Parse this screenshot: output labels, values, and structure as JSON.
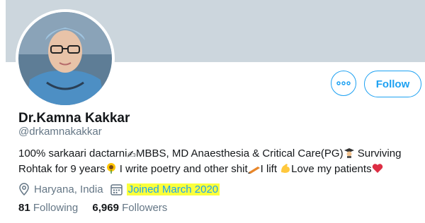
{
  "profile": {
    "display_name": "Dr.Kamna Kakkar",
    "handle": "@drkamnakakkar",
    "bio": {
      "line1_a": "100% sarkaari dactarni",
      "line1_b": "MBBS, MD Anaesthesia & Critical Care(PG)",
      "line1_c": " Surviving",
      "line2_a": "Rohtak for 9 years",
      "line2_b": " I write poetry and other shit",
      "line2_c": "I lift ",
      "line2_d": "Love my patients"
    },
    "location": "Haryana, India",
    "joined": "Joined March 2020",
    "following_count": "81",
    "following_label": "Following",
    "followers_count": "6,969",
    "followers_label": "Followers"
  },
  "actions": {
    "follow_label": "Follow",
    "more_icon": "more-icon"
  },
  "colors": {
    "accent": "#1da1f2",
    "muted": "#657786",
    "banner": "#ccd6dd",
    "highlight": "#fbff3c"
  }
}
